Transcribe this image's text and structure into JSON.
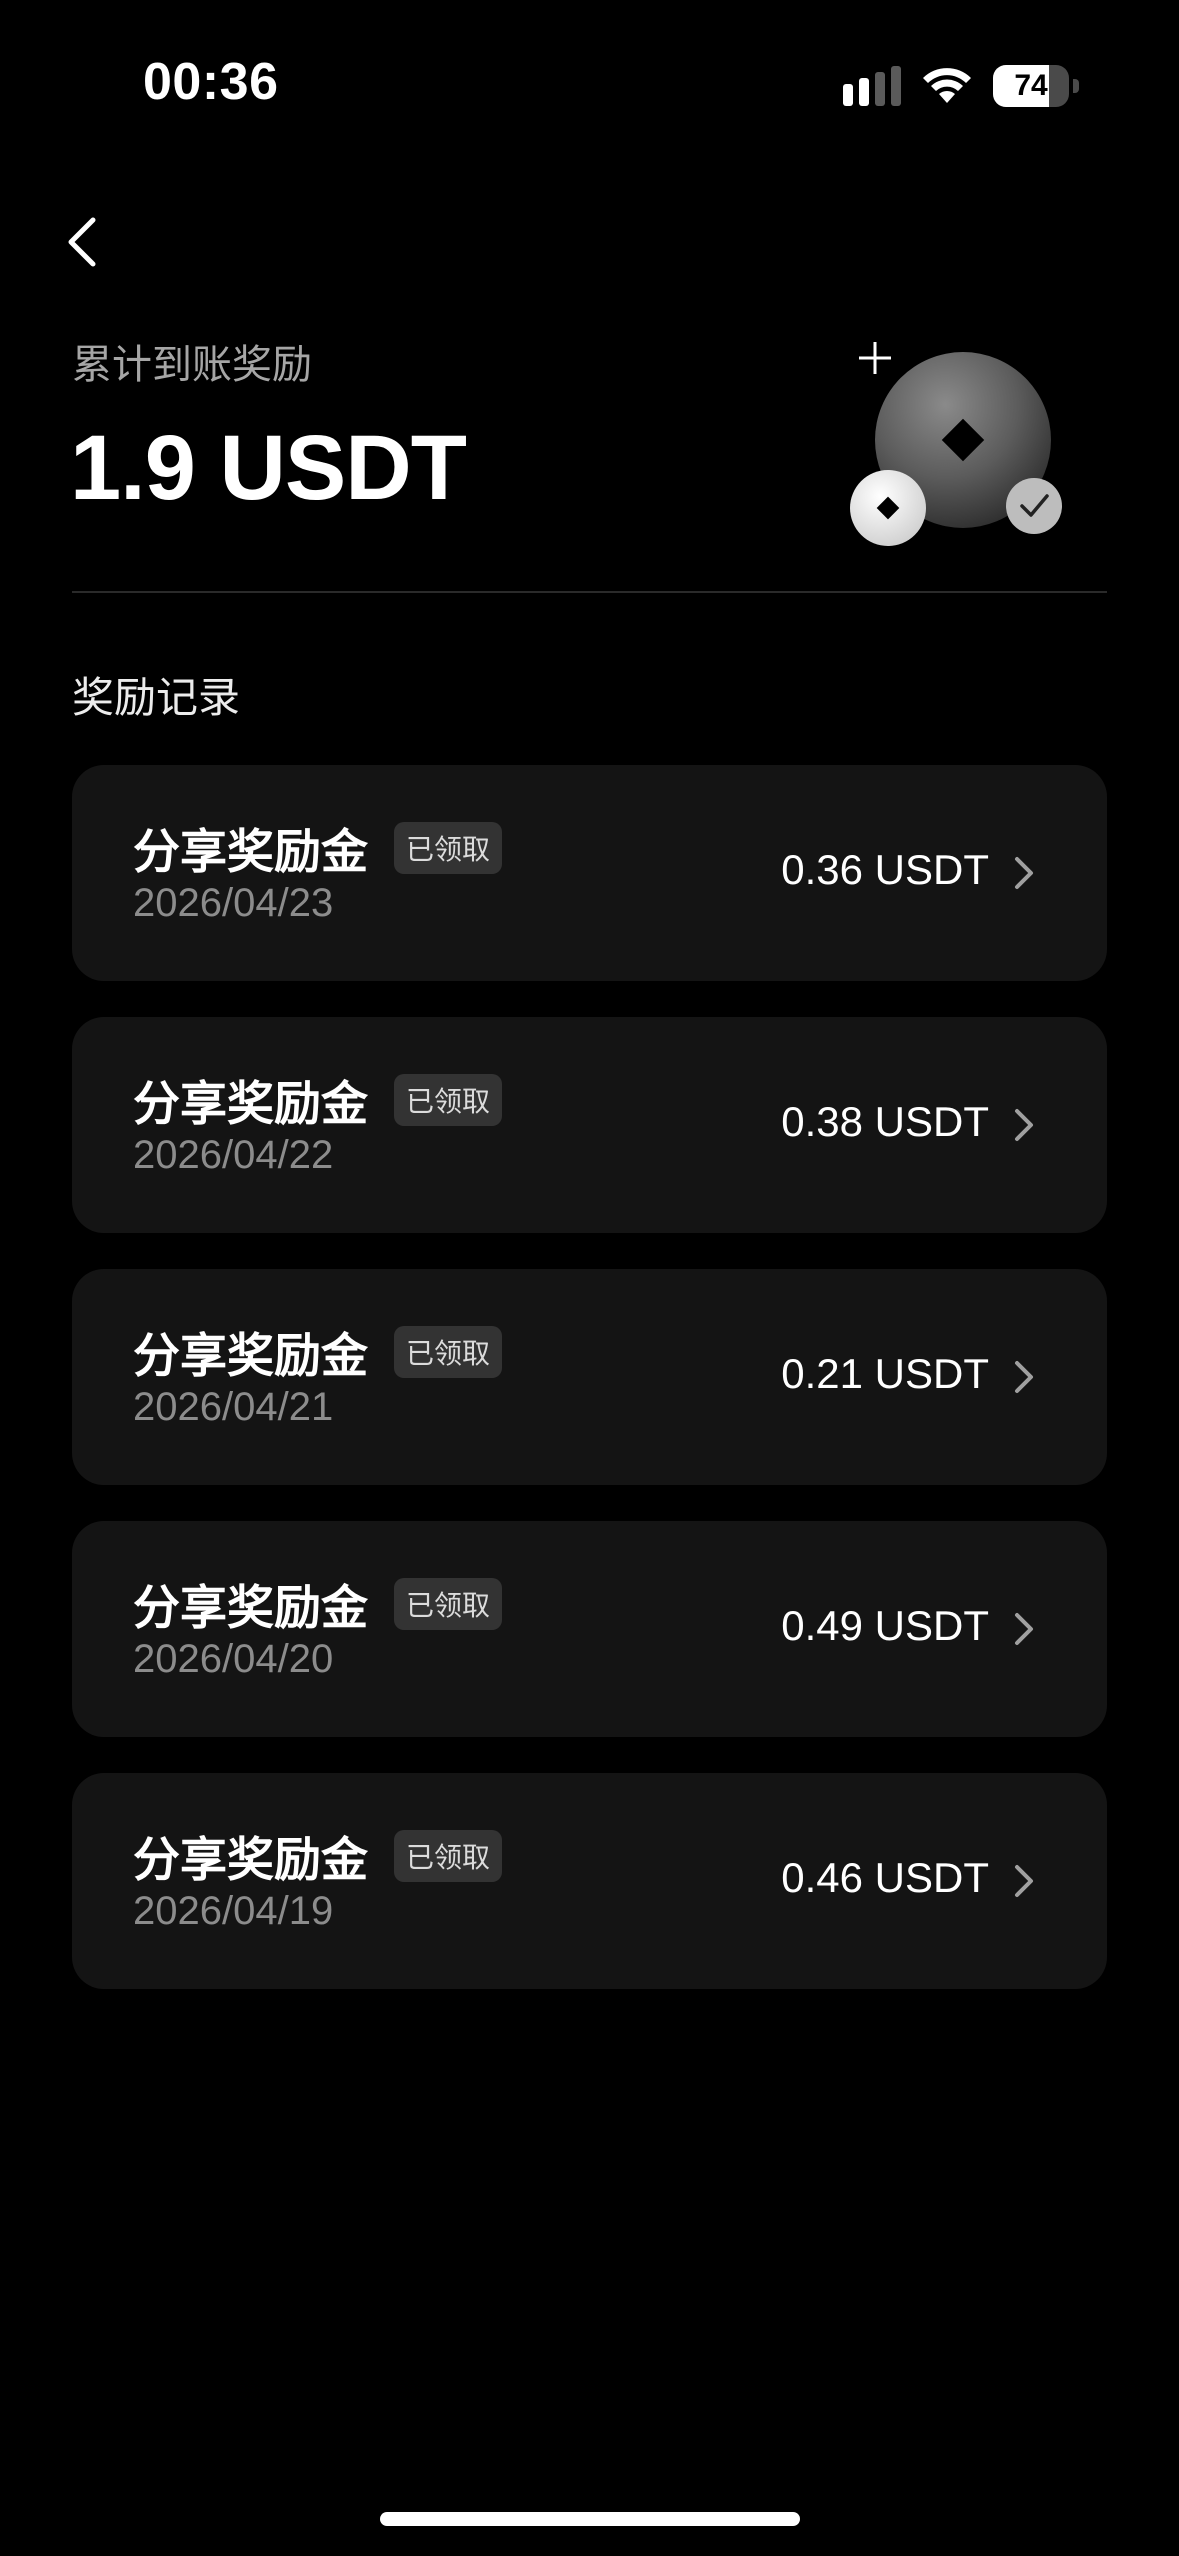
{
  "status_bar": {
    "time": "00:36",
    "battery_level": "74",
    "battery_fraction": 0.74,
    "icons": [
      "cellular-signal-icon",
      "wifi-icon",
      "battery-icon"
    ]
  },
  "nav": {
    "back_icon": "chevron-left-icon"
  },
  "summary": {
    "label": "累计到账奖励",
    "value": "1.9 USDT",
    "illustration_icon": "coin-check-illustration"
  },
  "records": {
    "title": "奖励记录",
    "items": [
      {
        "title": "分享奖励金",
        "status": "已领取",
        "date": "2026/04/23",
        "amount": "0.36 USDT"
      },
      {
        "title": "分享奖励金",
        "status": "已领取",
        "date": "2026/04/22",
        "amount": "0.38 USDT"
      },
      {
        "title": "分享奖励金",
        "status": "已领取",
        "date": "2026/04/21",
        "amount": "0.21 USDT"
      },
      {
        "title": "分享奖励金",
        "status": "已领取",
        "date": "2026/04/20",
        "amount": "0.49 USDT"
      },
      {
        "title": "分享奖励金",
        "status": "已领取",
        "date": "2026/04/19",
        "amount": "0.46 USDT"
      }
    ]
  },
  "colors": {
    "background": "#000000",
    "card": "#141414",
    "badge": "#333333",
    "muted_text": "#8c8c8c"
  }
}
